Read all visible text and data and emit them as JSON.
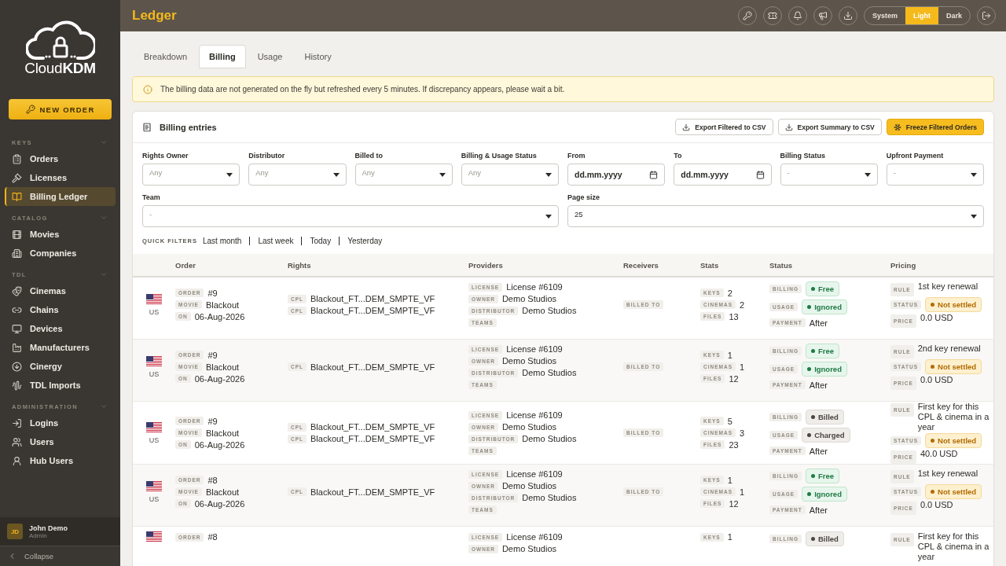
{
  "sidebar": {
    "logo": "Cloud**KDM**",
    "new_order": "NEW ORDER",
    "sections": [
      {
        "title": "KEYS",
        "expanded": true,
        "items": [
          {
            "label": "Orders",
            "selected": false
          },
          {
            "label": "Licenses",
            "selected": false
          },
          {
            "label": "Billing Ledger",
            "selected": true
          }
        ]
      },
      {
        "title": "CATALOG",
        "expanded": true,
        "items": [
          {
            "label": "Movies",
            "selected": false
          },
          {
            "label": "Companies",
            "selected": false
          }
        ]
      },
      {
        "title": "TDL",
        "expanded": true,
        "items": [
          {
            "label": "Cinemas",
            "selected": false
          },
          {
            "label": "Chains",
            "selected": false
          },
          {
            "label": "Devices",
            "selected": false
          },
          {
            "label": "Manufacturers",
            "selected": false
          },
          {
            "label": "Cinergy",
            "selected": false
          },
          {
            "label": "TDL Imports",
            "selected": false
          }
        ]
      },
      {
        "title": "ADMINISTRATION",
        "expanded": true,
        "items": [
          {
            "label": "Logins",
            "selected": false
          },
          {
            "label": "Users",
            "selected": false
          },
          {
            "label": "Hub Users",
            "selected": false
          }
        ]
      }
    ],
    "user": {
      "initials": "JD",
      "name": "John Demo",
      "role": "Admin"
    },
    "collapse": "Collapse"
  },
  "topbar": {
    "title": "Ledger",
    "theme_options": [
      {
        "label": "System",
        "selected": false
      },
      {
        "label": "Light",
        "selected": true
      },
      {
        "label": "Dark",
        "selected": false
      }
    ]
  },
  "tabs": [
    {
      "label": "Breakdown",
      "selected": false
    },
    {
      "label": "Billing",
      "selected": true
    },
    {
      "label": "Usage",
      "selected": false
    },
    {
      "label": "History",
      "selected": false
    }
  ],
  "notice": "The billing data are not generated on the fly but refreshed every 5 minutes. If discrepancy appears, please wait a bit.",
  "card": {
    "title": "Billing entries",
    "buttons": [
      {
        "label": "Export Filtered to CSV",
        "kind": "outline"
      },
      {
        "label": "Export Summary to CSV",
        "kind": "outline"
      },
      {
        "label": "Freeze Filtered Orders",
        "kind": "primary"
      }
    ]
  },
  "filters": [
    {
      "label": "Rights Owner",
      "kind": "select",
      "placeholder": "Any"
    },
    {
      "label": "Distributor",
      "kind": "select",
      "placeholder": "Any"
    },
    {
      "label": "Billed to",
      "kind": "select",
      "placeholder": "Any"
    },
    {
      "label": "Billing & Usage Status",
      "kind": "select",
      "placeholder": "Any"
    },
    {
      "label": "From",
      "kind": "date",
      "placeholder": "dd.mm.yyyy"
    },
    {
      "label": "To",
      "kind": "date",
      "placeholder": "dd.mm.yyyy"
    },
    {
      "label": "Billing Status",
      "kind": "select",
      "placeholder": "-"
    },
    {
      "label": "Upfront Payment",
      "kind": "select",
      "placeholder": "-"
    },
    {
      "label": "Team",
      "kind": "wide",
      "placeholder": "-"
    },
    {
      "label": "Page size",
      "kind": "wide",
      "value": "25"
    }
  ],
  "quick_filters": {
    "label": "QUICK FILTERS",
    "items": [
      "Last month",
      "Last week",
      "Today",
      "Yesterday"
    ]
  },
  "table": {
    "columns": [
      "Order",
      "Rights",
      "Providers",
      "Receivers",
      "Stats",
      "Status",
      "Pricing"
    ],
    "rows": [
      {
        "country": "US",
        "order": [
          {
            "tag": "ORDER",
            "value": "#9"
          },
          {
            "tag": "MOVIE",
            "value": "Blackout"
          },
          {
            "tag": "ON",
            "value": "06-Aug-2026"
          }
        ],
        "rights": [
          {
            "tag": "CPL",
            "value": "Blackout_FT...DEM_SMPTE_VF"
          },
          {
            "tag": "CPL",
            "value": "Blackout_FT...DEM_SMPTE_VF"
          }
        ],
        "providers": [
          {
            "tag": "LICENSE",
            "value": "License #6109"
          },
          {
            "tag": "OWNER",
            "value": "Demo Studios"
          },
          {
            "tag": "DISTRIBUTOR",
            "value": "Demo Studios"
          },
          {
            "tag": "TEAMS"
          }
        ],
        "receivers": [
          {
            "tag": "BILLED TO"
          }
        ],
        "stats": [
          {
            "tag": "KEYS",
            "value": "2"
          },
          {
            "tag": "CINEMAS",
            "value": "2"
          },
          {
            "tag": "FILES",
            "value": "13"
          }
        ],
        "status": [
          {
            "tag": "BILLING",
            "value": "Free",
            "kind": "positive"
          },
          {
            "tag": "USAGE",
            "value": "Ignored",
            "kind": "positive"
          },
          {
            "tag": "PAYMENT",
            "value": "After",
            "kind": "text"
          }
        ],
        "pricing": [
          {
            "tag": "RULE",
            "value": "1st key renewal",
            "kind": "text"
          },
          {
            "tag": "STATUS",
            "value": "Not settled",
            "kind": "warning"
          },
          {
            "tag": "PRICE",
            "value": "0.0 USD",
            "kind": "text"
          }
        ]
      },
      {
        "country": "US",
        "order": [
          {
            "tag": "ORDER",
            "value": "#9"
          },
          {
            "tag": "MOVIE",
            "value": "Blackout"
          },
          {
            "tag": "ON",
            "value": "06-Aug-2026"
          }
        ],
        "rights": [
          {
            "tag": "CPL",
            "value": "Blackout_FT...DEM_SMPTE_VF"
          }
        ],
        "providers": [
          {
            "tag": "LICENSE",
            "value": "License #6109"
          },
          {
            "tag": "OWNER",
            "value": "Demo Studios"
          },
          {
            "tag": "DISTRIBUTOR",
            "value": "Demo Studios"
          },
          {
            "tag": "TEAMS"
          }
        ],
        "receivers": [
          {
            "tag": "BILLED TO"
          }
        ],
        "stats": [
          {
            "tag": "KEYS",
            "value": "1"
          },
          {
            "tag": "CINEMAS",
            "value": "1"
          },
          {
            "tag": "FILES",
            "value": "12"
          }
        ],
        "status": [
          {
            "tag": "BILLING",
            "value": "Free",
            "kind": "positive"
          },
          {
            "tag": "USAGE",
            "value": "Ignored",
            "kind": "positive"
          },
          {
            "tag": "PAYMENT",
            "value": "After",
            "kind": "text"
          }
        ],
        "pricing": [
          {
            "tag": "RULE",
            "value": "2nd key renewal",
            "kind": "text"
          },
          {
            "tag": "STATUS",
            "value": "Not settled",
            "kind": "warning"
          },
          {
            "tag": "PRICE",
            "value": "0.0 USD",
            "kind": "text"
          }
        ]
      },
      {
        "country": "US",
        "order": [
          {
            "tag": "ORDER",
            "value": "#9"
          },
          {
            "tag": "MOVIE",
            "value": "Blackout"
          },
          {
            "tag": "ON",
            "value": "06-Aug-2026"
          }
        ],
        "rights": [
          {
            "tag": "CPL",
            "value": "Blackout_FT...DEM_SMPTE_VF"
          },
          {
            "tag": "CPL",
            "value": "Blackout_FT...DEM_SMPTE_VF"
          }
        ],
        "providers": [
          {
            "tag": "LICENSE",
            "value": "License #6109"
          },
          {
            "tag": "OWNER",
            "value": "Demo Studios"
          },
          {
            "tag": "DISTRIBUTOR",
            "value": "Demo Studios"
          },
          {
            "tag": "TEAMS"
          }
        ],
        "receivers": [
          {
            "tag": "BILLED TO"
          }
        ],
        "stats": [
          {
            "tag": "KEYS",
            "value": "5"
          },
          {
            "tag": "CINEMAS",
            "value": "3"
          },
          {
            "tag": "FILES",
            "value": "23"
          }
        ],
        "status": [
          {
            "tag": "BILLING",
            "value": "Billed",
            "kind": "neutral"
          },
          {
            "tag": "USAGE",
            "value": "Charged",
            "kind": "neutral"
          },
          {
            "tag": "PAYMENT",
            "value": "After",
            "kind": "text"
          }
        ],
        "pricing": [
          {
            "tag": "RULE",
            "value": "First key for this CPL & cinema in a year",
            "kind": "text"
          },
          {
            "tag": "STATUS",
            "value": "Not settled",
            "kind": "warning"
          },
          {
            "tag": "PRICE",
            "value": "40.0 USD",
            "kind": "text"
          }
        ]
      },
      {
        "country": "US",
        "order": [
          {
            "tag": "ORDER",
            "value": "#8"
          },
          {
            "tag": "MOVIE",
            "value": "Blackout"
          },
          {
            "tag": "ON",
            "value": "06-Aug-2026"
          }
        ],
        "rights": [
          {
            "tag": "CPL",
            "value": "Blackout_FT...DEM_SMPTE_VF"
          }
        ],
        "providers": [
          {
            "tag": "LICENSE",
            "value": "License #6109"
          },
          {
            "tag": "OWNER",
            "value": "Demo Studios"
          },
          {
            "tag": "DISTRIBUTOR",
            "value": "Demo Studios"
          },
          {
            "tag": "TEAMS"
          }
        ],
        "receivers": [
          {
            "tag": "BILLED TO"
          }
        ],
        "stats": [
          {
            "tag": "KEYS",
            "value": "1"
          },
          {
            "tag": "CINEMAS",
            "value": "1"
          },
          {
            "tag": "FILES",
            "value": "12"
          }
        ],
        "status": [
          {
            "tag": "BILLING",
            "value": "Free",
            "kind": "positive"
          },
          {
            "tag": "USAGE",
            "value": "Ignored",
            "kind": "positive"
          },
          {
            "tag": "PAYMENT",
            "value": "After",
            "kind": "text"
          }
        ],
        "pricing": [
          {
            "tag": "RULE",
            "value": "1st key renewal",
            "kind": "text"
          },
          {
            "tag": "STATUS",
            "value": "Not settled",
            "kind": "warning"
          },
          {
            "tag": "PRICE",
            "value": "0.0 USD",
            "kind": "text"
          }
        ]
      },
      {
        "order": [
          {
            "tag": "ORDER",
            "value": "#8"
          }
        ],
        "rights": [],
        "providers": [
          {
            "tag": "LICENSE",
            "value": "License #6109"
          },
          {
            "tag": "OWNER",
            "value": "Demo Studios"
          }
        ],
        "receivers": [],
        "stats": [
          {
            "tag": "KEYS",
            "value": "1"
          }
        ],
        "status": [
          {
            "tag": "BILLING",
            "value": "Billed",
            "kind": "neutral"
          }
        ],
        "pricing": [
          {
            "tag": "RULE",
            "value": "First key for this CPL & cinema in a year",
            "kind": "text"
          }
        ]
      }
    ]
  }
}
